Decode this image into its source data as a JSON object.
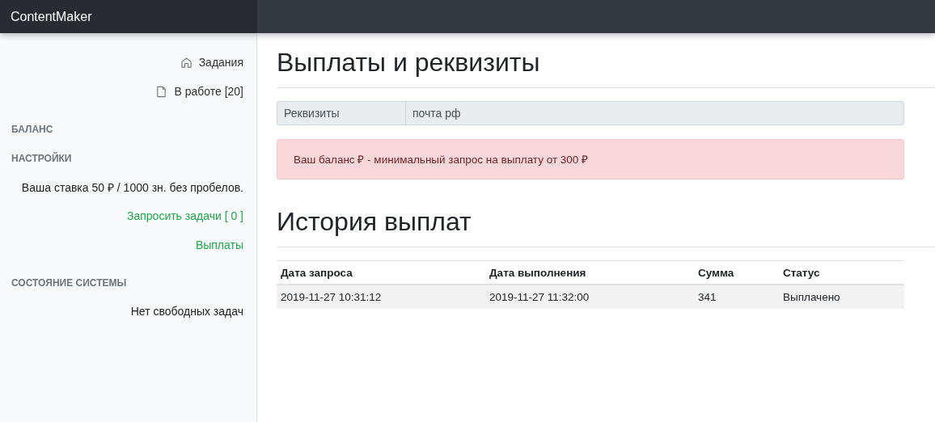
{
  "navbar": {
    "brand": "ContentMaker"
  },
  "sidebar": {
    "items": [
      {
        "kind": "nav",
        "label": "Задания"
      },
      {
        "kind": "nav",
        "label": "В работе [20]"
      },
      {
        "kind": "heading",
        "label": "БАЛАНС"
      },
      {
        "kind": "heading",
        "label": "НАСТРОЙКИ"
      },
      {
        "kind": "text",
        "label": "Ваша ставка 50 ₽ / 1000 зн. без пробелов."
      },
      {
        "kind": "link",
        "label": "Запросить задачи [ 0 ]"
      },
      {
        "kind": "link",
        "label": "Выплаты"
      },
      {
        "kind": "heading",
        "label": "СОСТОЯНИЕ СИСТЕМЫ"
      },
      {
        "kind": "text",
        "label": "Нет свободных задач"
      }
    ]
  },
  "main": {
    "title": "Выплаты и реквизиты",
    "requisites": {
      "label": "Реквизиты",
      "value": "почта рф"
    },
    "alert": "Ваш баланс ₽ - минимальный запрос на выплату от 300 ₽",
    "history_title": "История выплат",
    "table": {
      "columns": [
        "Дата запроса",
        "Дата выполнения",
        "Сумма",
        "Статус"
      ],
      "rows": [
        [
          "2019-11-27 10:31:12",
          "2019-11-27 11:32:00",
          "341",
          "Выплачено"
        ]
      ]
    }
  }
}
